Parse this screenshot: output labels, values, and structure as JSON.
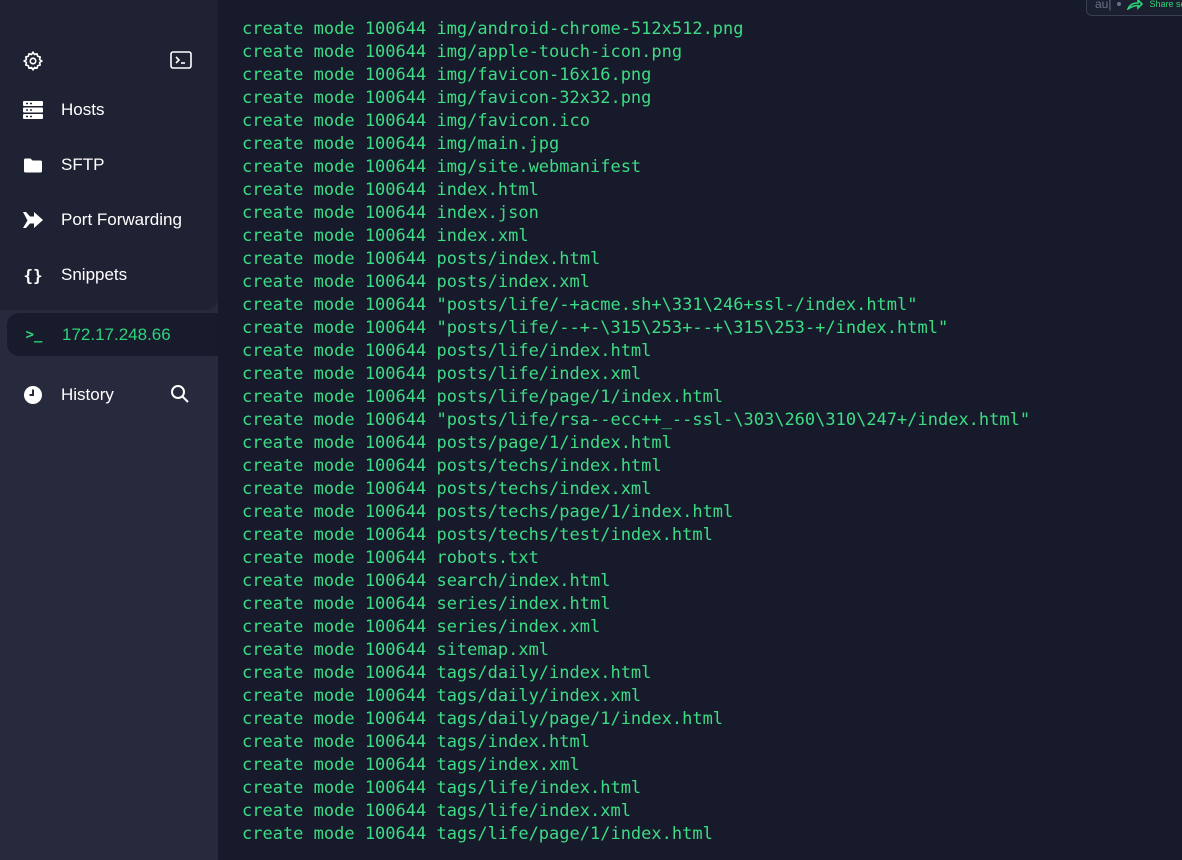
{
  "sidebar": {
    "nav": [
      {
        "label": "Hosts",
        "icon": "hosts-icon"
      },
      {
        "label": "SFTP",
        "icon": "folder-icon"
      },
      {
        "label": "Port Forwarding",
        "icon": "port-forward-icon"
      },
      {
        "label": "Snippets",
        "icon": "braces-icon"
      }
    ],
    "session": {
      "label": "172.17.248.66",
      "icon": "terminal-prompt-icon"
    },
    "history": {
      "label": "History",
      "icon": "clock-icon"
    }
  },
  "chip": {
    "partial": "au|",
    "share": "Share se"
  },
  "terminal": {
    "lines": [
      "create mode 100644 img/android-chrome-512x512.png",
      "create mode 100644 img/apple-touch-icon.png",
      "create mode 100644 img/favicon-16x16.png",
      "create mode 100644 img/favicon-32x32.png",
      "create mode 100644 img/favicon.ico",
      "create mode 100644 img/main.jpg",
      "create mode 100644 img/site.webmanifest",
      "create mode 100644 index.html",
      "create mode 100644 index.json",
      "create mode 100644 index.xml",
      "create mode 100644 posts/index.html",
      "create mode 100644 posts/index.xml",
      "create mode 100644 \"posts/life/-+acme.sh+\\331\\246+ssl-/index.html\"",
      "create mode 100644 \"posts/life/--+-\\315\\253+--+\\315\\253-+/index.html\"",
      "create mode 100644 posts/life/index.html",
      "create mode 100644 posts/life/index.xml",
      "create mode 100644 posts/life/page/1/index.html",
      "create mode 100644 \"posts/life/rsa--ecc++_--ssl-\\303\\260\\310\\247+/index.html\"",
      "create mode 100644 posts/page/1/index.html",
      "create mode 100644 posts/techs/index.html",
      "create mode 100644 posts/techs/index.xml",
      "create mode 100644 posts/techs/page/1/index.html",
      "create mode 100644 posts/techs/test/index.html",
      "create mode 100644 robots.txt",
      "create mode 100644 search/index.html",
      "create mode 100644 series/index.html",
      "create mode 100644 series/index.xml",
      "create mode 100644 sitemap.xml",
      "create mode 100644 tags/daily/index.html",
      "create mode 100644 tags/daily/index.xml",
      "create mode 100644 tags/daily/page/1/index.html",
      "create mode 100644 tags/index.html",
      "create mode 100644 tags/index.xml",
      "create mode 100644 tags/life/index.html",
      "create mode 100644 tags/life/index.xml",
      "create mode 100644 tags/life/page/1/index.html"
    ]
  },
  "colors": {
    "accent": "#2ed47a",
    "terminal_text": "#3ddc84",
    "terminal_bg": "#161a2b",
    "sidebar_bg": "#1f2233"
  }
}
